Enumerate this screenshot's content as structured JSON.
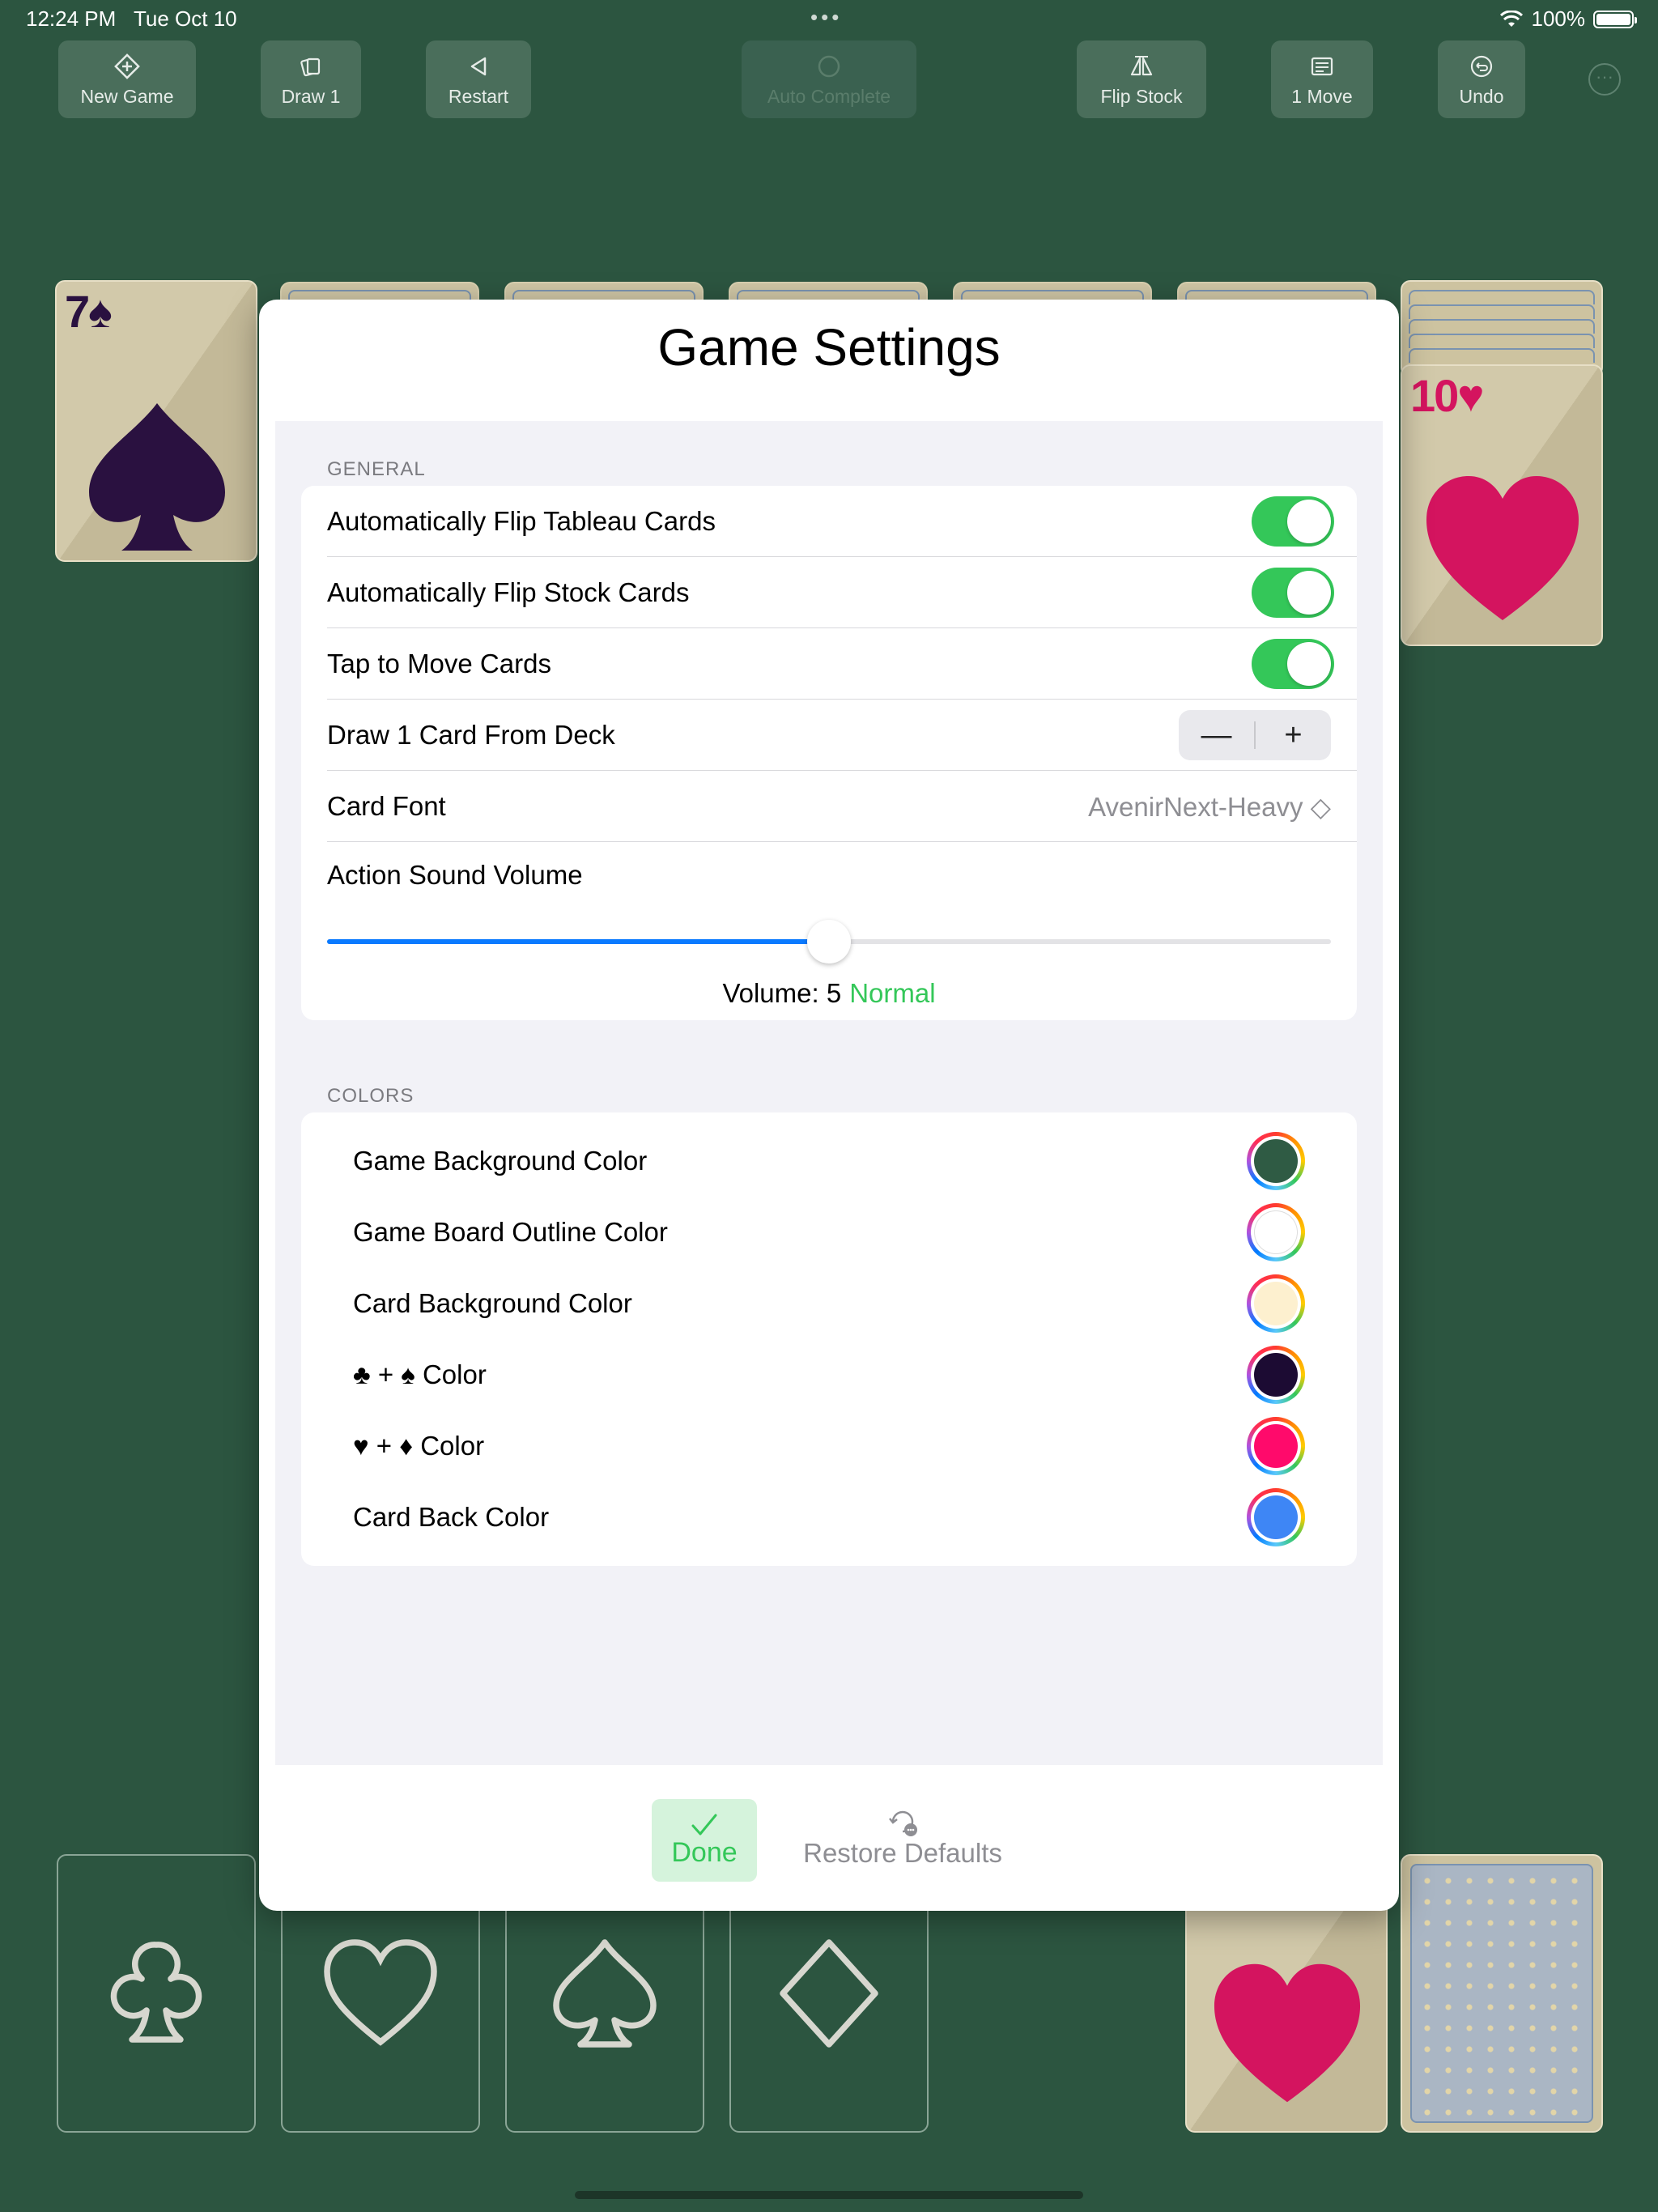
{
  "status": {
    "time": "12:24 PM",
    "date": "Tue Oct 10",
    "battery": "100%",
    "dots": "•••"
  },
  "toolbar": {
    "new_game": "New Game",
    "draw": "Draw 1",
    "restart": "Restart",
    "auto_complete": "Auto Complete",
    "flip_stock": "Flip Stock",
    "moves": "1 Move",
    "undo": "Undo",
    "more": "···"
  },
  "cards": {
    "waste_top": {
      "rank": "7",
      "suit": "♠"
    },
    "tableau_right": {
      "rank": "10",
      "suit": "♥"
    }
  },
  "settings": {
    "title": "Game Settings",
    "general_header": "GENERAL",
    "auto_flip_tableau": "Automatically Flip Tableau Cards",
    "auto_flip_stock": "Automatically Flip Stock Cards",
    "tap_to_move": "Tap to Move Cards",
    "draw_cards": "Draw 1 Card From Deck",
    "stepper_minus": "—",
    "stepper_plus": "+",
    "card_font_label": "Card Font",
    "card_font_value": "AvenirNext-Heavy ◇",
    "volume_label": "Action Sound Volume",
    "volume_value": 5,
    "volume_max": 10,
    "volume_text": "Volume: 5",
    "volume_status": "Normal",
    "colors_header": "COLORS",
    "colors": [
      {
        "label": "Game Background Color",
        "color": "#2f5b44"
      },
      {
        "label": "Game Board Outline Color",
        "color": "#ffffff"
      },
      {
        "label": "Card Background Color",
        "color": "#fdf0cf"
      },
      {
        "label": "♣ + ♠ Color",
        "color": "#1c0b33"
      },
      {
        "label": "♥ + ♦ Color",
        "color": "#ff0a6b"
      },
      {
        "label": "Card Back Color",
        "color": "#3e86f5"
      }
    ],
    "done": "Done",
    "restore_defaults": "Restore Defaults"
  },
  "palette": {
    "accent_green": "#34c759",
    "slider_blue": "#0a7aff",
    "spade": "#2a1140",
    "heart": "#d4145f"
  }
}
